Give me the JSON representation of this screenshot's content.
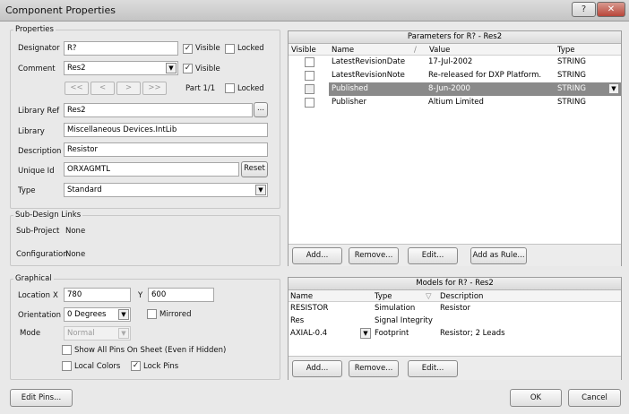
{
  "window": {
    "title": "Component Properties",
    "help_label": "?",
    "close_label": "✕"
  },
  "properties": {
    "group_label": "Properties",
    "designator": {
      "label": "Designator",
      "value": "R?",
      "visible_label": "Visible",
      "visible_checked": true,
      "locked_label": "Locked",
      "locked_checked": false
    },
    "comment": {
      "label": "Comment",
      "value": "Res2",
      "visible_label": "Visible",
      "visible_checked": true
    },
    "nav": {
      "first": "<<",
      "prev": "<",
      "next": ">",
      "last": ">>"
    },
    "part": {
      "text": "Part 1/1",
      "locked_label": "Locked",
      "locked_checked": false
    },
    "library_ref": {
      "label": "Library Ref",
      "value": "Res2",
      "browse_label": "..."
    },
    "library": {
      "label": "Library",
      "value": "Miscellaneous Devices.IntLib"
    },
    "description": {
      "label": "Description",
      "value": "Resistor"
    },
    "unique_id": {
      "label": "Unique Id",
      "value": "ORXAGMTL",
      "reset_label": "Reset"
    },
    "type": {
      "label": "Type",
      "value": "Standard"
    }
  },
  "sub_design": {
    "group_label": "Sub-Design Links",
    "sub_project": {
      "label": "Sub-Project",
      "value": "None"
    },
    "configuration": {
      "label": "Configuration",
      "value": "None"
    }
  },
  "graphical": {
    "group_label": "Graphical",
    "location": {
      "label": "Location",
      "x_label": "X",
      "x_value": "780",
      "y_label": "Y",
      "y_value": "600"
    },
    "orientation": {
      "label": "Orientation",
      "value": "0 Degrees",
      "mirrored_label": "Mirrored",
      "mirrored_checked": false
    },
    "mode": {
      "label": "Mode",
      "value": "Normal"
    },
    "show_all_pins": {
      "label": "Show All Pins On Sheet (Even if Hidden)",
      "checked": false
    },
    "local_colors": {
      "label": "Local Colors",
      "checked": false
    },
    "lock_pins": {
      "label": "Lock Pins",
      "checked": true
    }
  },
  "parameters": {
    "header": "Parameters for R? - Res2",
    "columns": {
      "visible": "Visible",
      "name": "Name",
      "value": "Value",
      "type": "Type",
      "sort_glyph": "/"
    },
    "rows": [
      {
        "visible": false,
        "name": "LatestRevisionDate",
        "value": "17-Jul-2002",
        "type": "STRING",
        "selected": false
      },
      {
        "visible": false,
        "name": "LatestRevisionNote",
        "value": "Re-released for DXP Platform.",
        "type": "STRING",
        "selected": false
      },
      {
        "visible": false,
        "name": "Published",
        "value": "8-Jun-2000",
        "type": "STRING",
        "selected": true
      },
      {
        "visible": false,
        "name": "Publisher",
        "value": "Altium Limited",
        "type": "STRING",
        "selected": false
      }
    ],
    "buttons": {
      "add": "Add...",
      "remove": "Remove...",
      "edit": "Edit...",
      "add_rule": "Add as Rule..."
    }
  },
  "models": {
    "header": "Models for R? - Res2",
    "columns": {
      "name": "Name",
      "type": "Type",
      "description": "Description",
      "sort_glyph": "▽"
    },
    "rows": [
      {
        "name": "RESISTOR",
        "type": "Simulation",
        "description": "Resistor"
      },
      {
        "name": "Res",
        "type": "Signal Integrity",
        "description": ""
      },
      {
        "name": "AXIAL-0.4",
        "type": "Footprint",
        "description": "Resistor; 2 Leads"
      }
    ],
    "buttons": {
      "add": "Add...",
      "remove": "Remove...",
      "edit": "Edit..."
    }
  },
  "footer": {
    "edit_pins": "Edit Pins...",
    "ok": "OK",
    "cancel": "Cancel"
  },
  "icons": {
    "dropdown": "chevron-down-icon",
    "check": "checkmark-icon",
    "help": "help-icon",
    "close": "close-icon"
  },
  "colors": {
    "selection": "#8a8a8a",
    "close_button": "#b8463a"
  }
}
